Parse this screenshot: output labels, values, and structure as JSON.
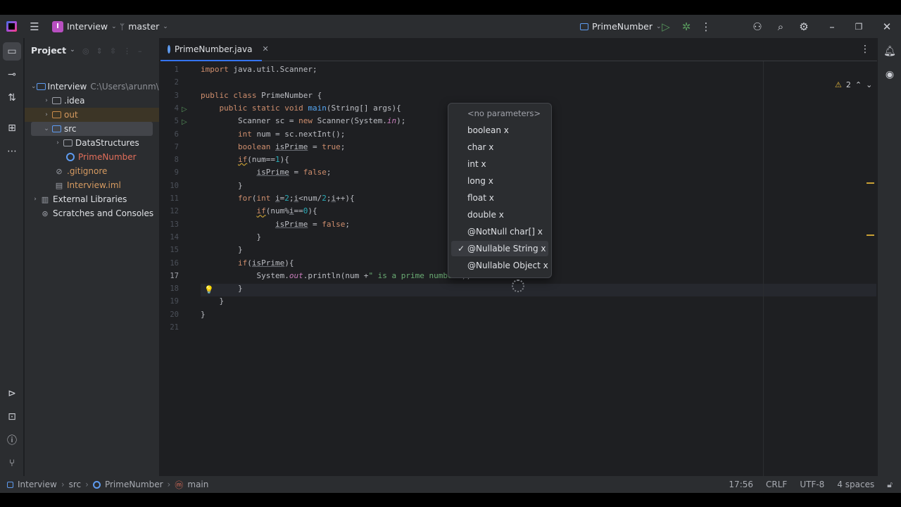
{
  "titlebar": {
    "project_name": "Interview",
    "project_badge": "I",
    "branch": "master",
    "run_config": "PrimeNumber"
  },
  "project_panel": {
    "title": "Project",
    "tree": [
      {
        "label": "Interview",
        "extra": "C:\\Users\\arunm\\I",
        "icon": "module-folder-icon",
        "expanded": true,
        "depth": 0
      },
      {
        "label": ".idea",
        "icon": "folder-icon",
        "expanded": false,
        "depth": 1
      },
      {
        "label": "out",
        "icon": "folder-excluded-icon",
        "expanded": false,
        "depth": 1
      },
      {
        "label": "src",
        "icon": "folder-source-icon",
        "expanded": true,
        "depth": 1
      },
      {
        "label": "DataStructures",
        "icon": "package-icon",
        "expanded": false,
        "depth": 2
      },
      {
        "label": "PrimeNumber",
        "icon": "java-class-icon",
        "depth": 2
      },
      {
        "label": ".gitignore",
        "icon": "gitignore-file-icon",
        "depth": 1
      },
      {
        "label": "Interview.iml",
        "icon": "iml-file-icon",
        "depth": 1
      },
      {
        "label": "External Libraries",
        "icon": "library-icon",
        "expanded": false,
        "depth": 0
      },
      {
        "label": "Scratches and Consoles",
        "icon": "scratches-icon",
        "depth": 0
      }
    ]
  },
  "editor": {
    "tab_label": "PrimeNumber.java",
    "warnings_count": "2",
    "current_line": 17,
    "line_numbers": [
      "1",
      "2",
      "3",
      "4",
      "5",
      "6",
      "7",
      "8",
      "9",
      "10",
      "11",
      "12",
      "13",
      "14",
      "15",
      "16",
      "17",
      "18",
      "19",
      "20",
      "21"
    ]
  },
  "popup": {
    "header": "<no parameters>",
    "items": [
      "boolean x",
      "char x",
      "int x",
      "long x",
      "float x",
      "double x",
      "@NotNull char[] x",
      "@Nullable String x",
      "@Nullable Object x"
    ],
    "selected_index": 7
  },
  "statusbar": {
    "breadcrumb": [
      "Interview",
      "src",
      "PrimeNumber",
      "main"
    ],
    "position": "17:56",
    "line_sep": "CRLF",
    "encoding": "UTF-8",
    "indent": "4 spaces"
  },
  "colors": {
    "accent": "#3574f0",
    "run_green": "#57965c",
    "warning": "#e4b73d"
  }
}
